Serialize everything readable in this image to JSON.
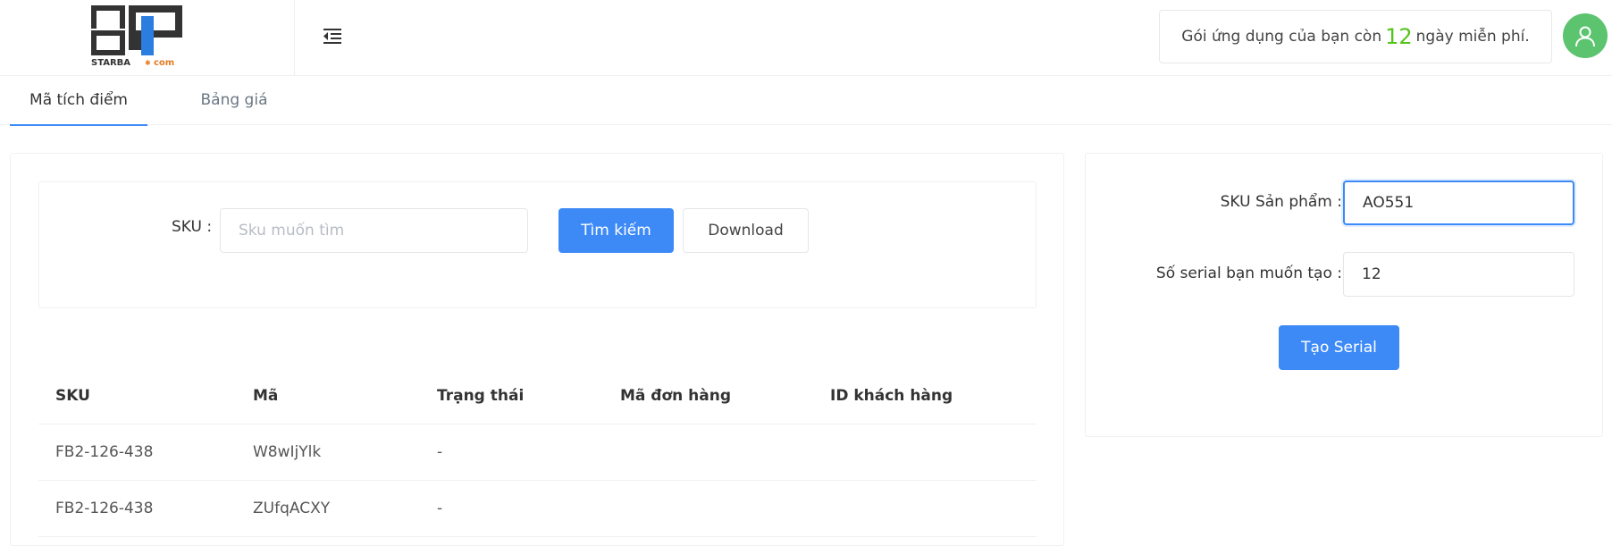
{
  "header": {
    "logo_text": "STARBA",
    "logo_suffix": "com",
    "trial_prefix": "Gói ứng dụng của bạn còn",
    "trial_days": "12",
    "trial_suffix": "ngày miễn phí."
  },
  "tabs": [
    {
      "label": "Mã tích điểm",
      "active": true
    },
    {
      "label": "Bảng giá",
      "active": false
    }
  ],
  "search": {
    "sku_label": "SKU :",
    "sku_placeholder": "Sku muốn tìm",
    "search_button": "Tìm kiếm",
    "download_button": "Download"
  },
  "table": {
    "headers": [
      "SKU",
      "Mã",
      "Trạng thái",
      "Mã đơn hàng",
      "ID khách hàng"
    ],
    "rows": [
      [
        "FB2-126-438",
        "W8wIjYlk",
        "-",
        "",
        ""
      ],
      [
        "FB2-126-438",
        "ZUfqACXY",
        "-",
        "",
        ""
      ]
    ]
  },
  "form": {
    "sku_label": "SKU Sản phẩm :",
    "sku_value": "AO551",
    "serial_label": "Số serial bạn muốn tạo :",
    "serial_value": "12",
    "create_button": "Tạo Serial"
  },
  "colors": {
    "accent": "#3d8af7",
    "trial_days": "#52c41a",
    "avatar_bg": "#5cc36f"
  },
  "icons": {
    "menu": "menu-fold-icon",
    "avatar": "user-icon"
  }
}
